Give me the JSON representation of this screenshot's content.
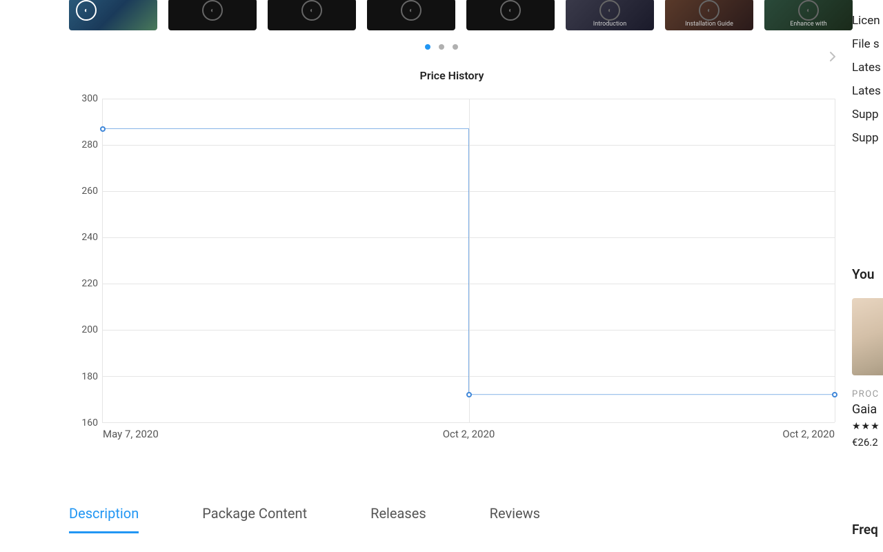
{
  "carousel": {
    "thumbs": [
      {
        "caption": "",
        "variant": "first"
      },
      {
        "caption": "",
        "variant": "dark"
      },
      {
        "caption": "",
        "variant": "dark"
      },
      {
        "caption": "",
        "variant": "dark"
      },
      {
        "caption": "",
        "variant": "dark"
      },
      {
        "caption": "Introduction",
        "variant": "darkpic"
      },
      {
        "caption": "Installation Guide",
        "variant": "darkpic"
      },
      {
        "caption": "Enhance with",
        "variant": "darkpic"
      }
    ],
    "active_dot": 0,
    "dot_count": 3
  },
  "chart_data": {
    "type": "step-line",
    "title": "Price History",
    "xlabel": "",
    "ylabel": "",
    "ylim": [
      160,
      300
    ],
    "y_ticks": [
      160,
      180,
      200,
      220,
      240,
      260,
      280,
      300
    ],
    "x_ticks": [
      "May 7, 2020",
      "Oct 2, 2020",
      "Oct 2, 2020"
    ],
    "x": [
      "May 7, 2020",
      "Oct 2, 2020",
      "Oct 2, 2020"
    ],
    "values": [
      287,
      287,
      172
    ],
    "points": [
      {
        "x_index": 0,
        "y": 287
      },
      {
        "x_index": 1,
        "y": 172
      },
      {
        "x_index": 2,
        "y": 172
      }
    ],
    "line_color": "#3f87d9"
  },
  "tabs": {
    "items": [
      {
        "label": "Description",
        "active": true
      },
      {
        "label": "Package Content",
        "active": false
      },
      {
        "label": "Releases",
        "active": false
      },
      {
        "label": "Reviews",
        "active": false
      }
    ]
  },
  "side_labels": [
    "Licen",
    "File s",
    "Lates",
    "Lates",
    "Supp",
    "Supp"
  ],
  "side_heading": "You",
  "side_card": {
    "eyebrow": "PROC",
    "title": "Gaia",
    "stars": "★★★",
    "price": "€26.2"
  },
  "side_bottom_heading": "Freq"
}
